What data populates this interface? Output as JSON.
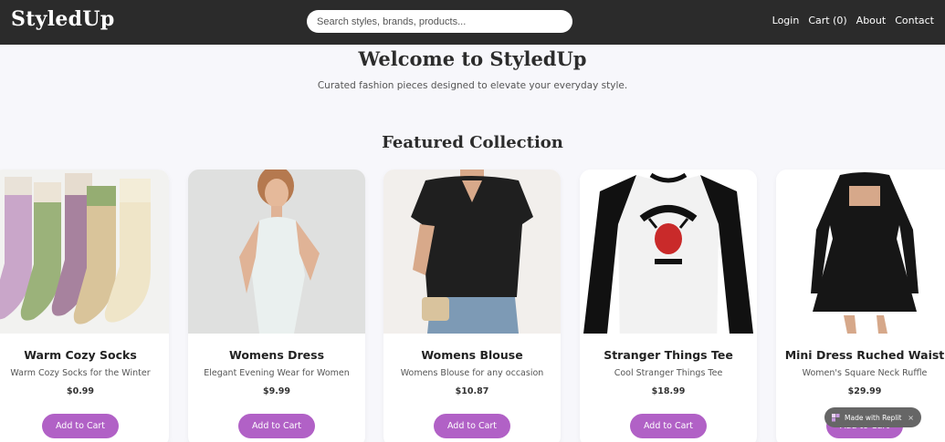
{
  "brand": "StyledUp",
  "search": {
    "placeholder": "Search styles, brands, products..."
  },
  "nav": {
    "login": "Login",
    "cart": "Cart (0)",
    "about": "About",
    "contact": "Contact"
  },
  "hero": {
    "title": "Welcome to StyledUp",
    "subtitle": "Curated fashion pieces designed to elevate your everyday style."
  },
  "featured_title": "Featured Collection",
  "products": [
    {
      "name": "Warm Cozy Socks",
      "description": "Warm Cozy Socks for the Winter",
      "price": "$0.99",
      "button": "Add to Cart"
    },
    {
      "name": "Womens Dress",
      "description": "Elegant Evening Wear for Women",
      "price": "$9.99",
      "button": "Add to Cart"
    },
    {
      "name": "Womens Blouse",
      "description": "Womens Blouse for any occasion",
      "price": "$10.87",
      "button": "Add to Cart"
    },
    {
      "name": "Stranger Things Tee",
      "description": "Cool Stranger Things Tee",
      "price": "$18.99",
      "button": "Add to Cart"
    },
    {
      "name": "Mini Dress Ruched Waist",
      "description": "Women's Square Neck Ruffle",
      "price": "$29.99",
      "button": "Add to Cart"
    }
  ],
  "replit_badge": {
    "label": "Made with Replit",
    "close": "×"
  },
  "colors": {
    "navbar": "#2b2b2b",
    "accent": "#b161c6",
    "background": "#f7f7fb"
  }
}
